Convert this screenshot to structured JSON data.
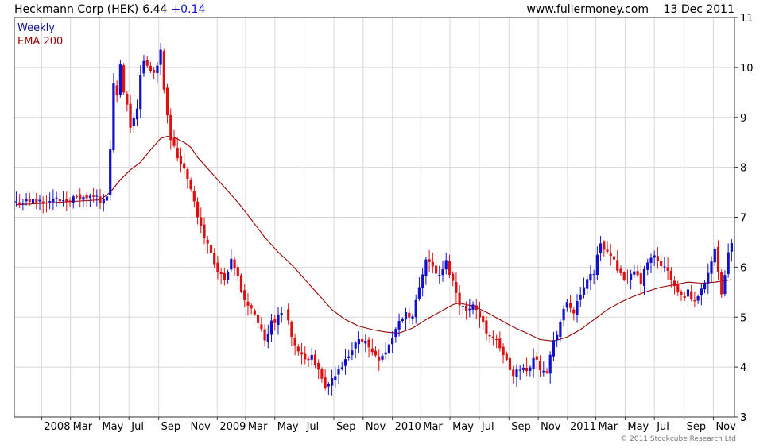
{
  "header": {
    "title_left": "Heckmann Corp (HEK)",
    "price": "6.44",
    "change": "+0.14",
    "website": "www.fullermoney.com",
    "date": "13 Dec 2011"
  },
  "legend": {
    "period": "Weekly",
    "indicator": "EMA 200"
  },
  "footer": {
    "copyright": "© 2011 Stockcube Research Ltd"
  },
  "colors": {
    "up": "#1010cc",
    "down": "#dd1111",
    "ema": "#990000",
    "grid": "#d8d8d8",
    "frame": "#333333",
    "title": "#000000",
    "change": "#1010cc",
    "legend_period": "#101090",
    "legend_indicator": "#990000",
    "footer": "#777777"
  },
  "chart_data": {
    "type": "candlestick",
    "period": "weekly",
    "y_axis": {
      "min": 3,
      "max": 11,
      "ticks": [
        3,
        4,
        5,
        6,
        7,
        8,
        9,
        10,
        11
      ],
      "side": "right"
    },
    "x_axis": {
      "ticks": [
        {
          "label": "2008",
          "date": "2008-01-01"
        },
        {
          "label": "Mar",
          "date": "2008-03-01"
        },
        {
          "label": "May",
          "date": "2008-05-01"
        },
        {
          "label": "Jul",
          "date": "2008-07-01"
        },
        {
          "label": "Sep",
          "date": "2008-09-01"
        },
        {
          "label": "Nov",
          "date": "2008-11-01"
        },
        {
          "label": "2009",
          "date": "2009-01-01"
        },
        {
          "label": "Mar",
          "date": "2009-03-01"
        },
        {
          "label": "May",
          "date": "2009-05-01"
        },
        {
          "label": "Jul",
          "date": "2009-07-01"
        },
        {
          "label": "Sep",
          "date": "2009-09-01"
        },
        {
          "label": "Nov",
          "date": "2009-11-01"
        },
        {
          "label": "2010",
          "date": "2010-01-01"
        },
        {
          "label": "Mar",
          "date": "2010-03-01"
        },
        {
          "label": "May",
          "date": "2010-05-01"
        },
        {
          "label": "Jul",
          "date": "2010-07-01"
        },
        {
          "label": "Sep",
          "date": "2010-09-01"
        },
        {
          "label": "Nov",
          "date": "2010-11-01"
        },
        {
          "label": "2011",
          "date": "2011-01-01"
        },
        {
          "label": "Mar",
          "date": "2011-03-01"
        },
        {
          "label": "May",
          "date": "2011-05-01"
        },
        {
          "label": "Jul",
          "date": "2011-07-01"
        },
        {
          "label": "Sep",
          "date": "2011-09-01"
        },
        {
          "label": "Nov",
          "date": "2011-11-01"
        }
      ]
    },
    "close_path": [
      [
        "2007-11-09",
        7.3
      ],
      [
        "2008-04-25",
        7.4
      ],
      [
        "2008-05-02",
        7.35
      ],
      [
        "2008-05-16",
        7.45
      ],
      [
        "2008-05-23",
        8.3
      ],
      [
        "2008-05-30",
        9.7
      ],
      [
        "2008-06-06",
        9.4
      ],
      [
        "2008-06-13",
        10.0
      ],
      [
        "2008-06-20",
        9.5
      ],
      [
        "2008-06-27",
        9.2
      ],
      [
        "2008-07-04",
        8.75
      ],
      [
        "2008-07-11",
        9.0
      ],
      [
        "2008-07-18",
        9.2
      ],
      [
        "2008-07-25",
        9.9
      ],
      [
        "2008-08-01",
        10.1
      ],
      [
        "2008-08-15",
        9.9
      ],
      [
        "2008-08-29",
        10.0
      ],
      [
        "2008-09-05",
        10.4
      ],
      [
        "2008-09-12",
        9.6
      ],
      [
        "2008-09-26",
        8.6
      ],
      [
        "2008-10-10",
        8.2
      ],
      [
        "2008-10-24",
        8.0
      ],
      [
        "2008-11-07",
        7.6
      ],
      [
        "2008-11-21",
        7.0
      ],
      [
        "2008-12-05",
        6.6
      ],
      [
        "2008-12-19",
        6.3
      ],
      [
        "2009-01-02",
        5.9
      ],
      [
        "2009-01-16",
        5.7
      ],
      [
        "2009-01-30",
        6.1
      ],
      [
        "2009-02-13",
        5.8
      ],
      [
        "2009-02-27",
        5.3
      ],
      [
        "2009-03-13",
        5.2
      ],
      [
        "2009-03-27",
        4.9
      ],
      [
        "2009-04-10",
        4.5
      ],
      [
        "2009-04-24",
        4.9
      ],
      [
        "2009-05-08",
        5.0
      ],
      [
        "2009-05-22",
        5.2
      ],
      [
        "2009-06-05",
        4.6
      ],
      [
        "2009-06-19",
        4.3
      ],
      [
        "2009-07-03",
        4.1
      ],
      [
        "2009-07-17",
        4.3
      ],
      [
        "2009-07-31",
        3.9
      ],
      [
        "2009-08-14",
        3.55
      ],
      [
        "2009-08-28",
        3.75
      ],
      [
        "2009-09-11",
        3.9
      ],
      [
        "2009-09-25",
        4.1
      ],
      [
        "2009-10-09",
        4.3
      ],
      [
        "2009-10-23",
        4.6
      ],
      [
        "2009-11-06",
        4.5
      ],
      [
        "2009-11-20",
        4.3
      ],
      [
        "2009-12-04",
        4.2
      ],
      [
        "2009-12-18",
        4.3
      ],
      [
        "2010-01-01",
        4.6
      ],
      [
        "2010-01-15",
        4.9
      ],
      [
        "2010-01-29",
        5.1
      ],
      [
        "2010-02-12",
        5.0
      ],
      [
        "2010-02-26",
        5.6
      ],
      [
        "2010-03-12",
        6.2
      ],
      [
        "2010-03-26",
        6.0
      ],
      [
        "2010-04-09",
        5.8
      ],
      [
        "2010-04-23",
        6.1
      ],
      [
        "2010-05-07",
        5.7
      ],
      [
        "2010-05-21",
        5.3
      ],
      [
        "2010-06-04",
        5.1
      ],
      [
        "2010-06-18",
        5.3
      ],
      [
        "2010-07-02",
        5.0
      ],
      [
        "2010-07-16",
        4.7
      ],
      [
        "2010-07-30",
        4.6
      ],
      [
        "2010-08-13",
        4.4
      ],
      [
        "2010-08-27",
        4.1
      ],
      [
        "2010-09-10",
        3.8
      ],
      [
        "2010-09-24",
        4.0
      ],
      [
        "2010-10-08",
        3.9
      ],
      [
        "2010-10-22",
        4.2
      ],
      [
        "2010-11-05",
        4.0
      ],
      [
        "2010-11-19",
        3.95
      ],
      [
        "2010-12-03",
        4.5
      ],
      [
        "2010-12-17",
        4.9
      ],
      [
        "2010-12-31",
        5.3
      ],
      [
        "2011-01-14",
        5.1
      ],
      [
        "2011-01-28",
        5.4
      ],
      [
        "2011-02-11",
        5.8
      ],
      [
        "2011-02-25",
        5.9
      ],
      [
        "2011-03-11",
        6.5
      ],
      [
        "2011-03-25",
        6.3
      ],
      [
        "2011-04-08",
        6.1
      ],
      [
        "2011-04-22",
        5.9
      ],
      [
        "2011-05-06",
        5.7
      ],
      [
        "2011-05-20",
        5.9
      ],
      [
        "2011-06-03",
        5.7
      ],
      [
        "2011-06-17",
        6.1
      ],
      [
        "2011-07-01",
        6.2
      ],
      [
        "2011-07-15",
        6.05
      ],
      [
        "2011-07-29",
        5.9
      ],
      [
        "2011-08-12",
        5.6
      ],
      [
        "2011-08-26",
        5.4
      ],
      [
        "2011-09-09",
        5.5
      ],
      [
        "2011-09-23",
        5.3
      ],
      [
        "2011-10-07",
        5.6
      ],
      [
        "2011-10-21",
        5.9
      ],
      [
        "2011-11-04",
        6.3
      ],
      [
        "2011-11-18",
        5.4
      ],
      [
        "2011-11-25",
        5.9
      ],
      [
        "2011-12-02",
        6.3
      ],
      [
        "2011-12-09",
        6.44
      ]
    ],
    "ema_200": [
      [
        "2007-11-09",
        7.25
      ],
      [
        "2008-05-02",
        7.35
      ],
      [
        "2008-05-23",
        7.5
      ],
      [
        "2008-06-13",
        7.75
      ],
      [
        "2008-07-04",
        7.95
      ],
      [
        "2008-07-25",
        8.1
      ],
      [
        "2008-08-15",
        8.35
      ],
      [
        "2008-09-05",
        8.58
      ],
      [
        "2008-09-19",
        8.62
      ],
      [
        "2008-10-03",
        8.6
      ],
      [
        "2008-10-24",
        8.5
      ],
      [
        "2008-11-07",
        8.4
      ],
      [
        "2008-11-21",
        8.2
      ],
      [
        "2008-12-19",
        7.9
      ],
      [
        "2009-01-16",
        7.6
      ],
      [
        "2009-02-13",
        7.3
      ],
      [
        "2009-03-13",
        6.95
      ],
      [
        "2009-04-10",
        6.6
      ],
      [
        "2009-05-08",
        6.3
      ],
      [
        "2009-06-05",
        6.05
      ],
      [
        "2009-07-03",
        5.75
      ],
      [
        "2009-07-31",
        5.45
      ],
      [
        "2009-08-28",
        5.15
      ],
      [
        "2009-09-25",
        4.95
      ],
      [
        "2009-10-23",
        4.82
      ],
      [
        "2009-11-20",
        4.75
      ],
      [
        "2009-12-18",
        4.7
      ],
      [
        "2010-01-15",
        4.68
      ],
      [
        "2010-02-12",
        4.78
      ],
      [
        "2010-03-12",
        4.95
      ],
      [
        "2010-04-09",
        5.1
      ],
      [
        "2010-05-07",
        5.25
      ],
      [
        "2010-05-21",
        5.28
      ],
      [
        "2010-06-18",
        5.22
      ],
      [
        "2010-07-16",
        5.1
      ],
      [
        "2010-08-13",
        4.95
      ],
      [
        "2010-09-10",
        4.8
      ],
      [
        "2010-10-08",
        4.68
      ],
      [
        "2010-11-05",
        4.55
      ],
      [
        "2010-12-03",
        4.52
      ],
      [
        "2010-12-31",
        4.6
      ],
      [
        "2011-01-28",
        4.75
      ],
      [
        "2011-02-25",
        4.95
      ],
      [
        "2011-03-25",
        5.15
      ],
      [
        "2011-04-22",
        5.3
      ],
      [
        "2011-05-20",
        5.42
      ],
      [
        "2011-06-17",
        5.52
      ],
      [
        "2011-07-15",
        5.6
      ],
      [
        "2011-08-12",
        5.65
      ],
      [
        "2011-09-09",
        5.7
      ],
      [
        "2011-10-07",
        5.68
      ],
      [
        "2011-11-04",
        5.7
      ],
      [
        "2011-12-09",
        5.75
      ]
    ]
  }
}
